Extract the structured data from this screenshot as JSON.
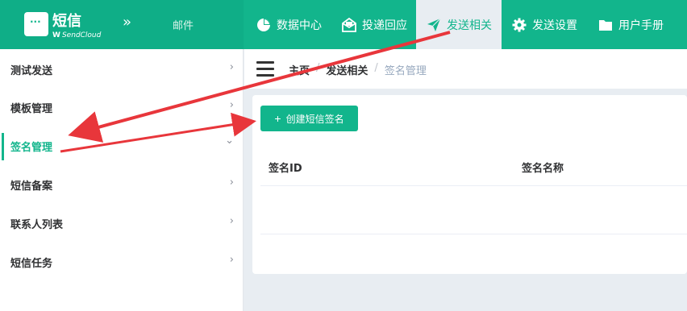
{
  "brand": {
    "title": "短信",
    "subtitle_mark": "W",
    "subtitle": "SendCloud",
    "mail_link": "邮件"
  },
  "nav": [
    {
      "label": "数据中心",
      "icon": "pie-chart-icon"
    },
    {
      "label": "投递回应",
      "icon": "envelope-open-icon"
    },
    {
      "label": "发送相关",
      "icon": "paper-plane-icon",
      "active": true
    },
    {
      "label": "发送设置",
      "icon": "gear-icon"
    },
    {
      "label": "用户手册",
      "icon": "folder-icon"
    }
  ],
  "sidebar": {
    "items": [
      {
        "label": "测试发送",
        "arrow": "›"
      },
      {
        "label": "模板管理",
        "arrow": "›"
      },
      {
        "label": "签名管理",
        "arrow": "⌄",
        "active": true
      },
      {
        "label": "短信备案",
        "arrow": "›"
      },
      {
        "label": "联系人列表",
        "arrow": "›"
      },
      {
        "label": "短信任务",
        "arrow": "›"
      }
    ]
  },
  "breadcrumb": {
    "home": "主页",
    "section": "发送相关",
    "current": "签名管理",
    "separator": "/"
  },
  "content": {
    "create_button": "创建短信签名",
    "create_button_icon": "+",
    "table_headers": [
      "签名ID",
      "签名名称"
    ]
  },
  "colors": {
    "accent": "#12b58c",
    "annotation": "#e8363b"
  }
}
